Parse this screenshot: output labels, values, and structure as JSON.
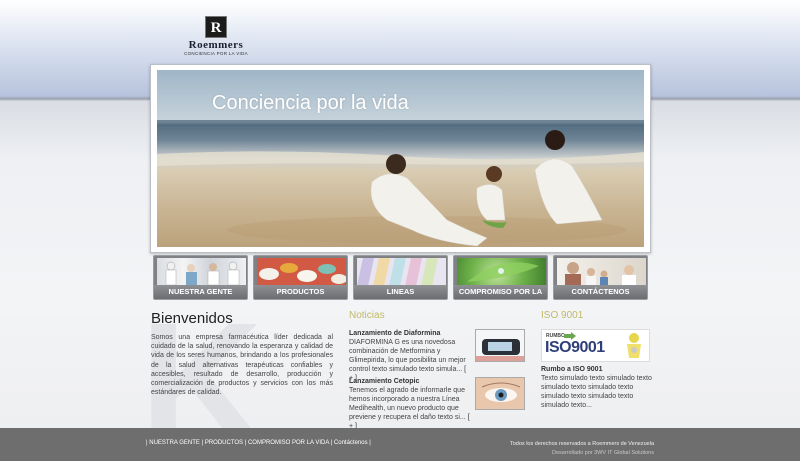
{
  "brand": {
    "logo_letter": "R",
    "name": "Roemmers",
    "tagline": "CONCIENCIA POR LA VIDA"
  },
  "hero": {
    "title": "Conciencia por la vida"
  },
  "nav": [
    {
      "label": "NUESTRA GENTE"
    },
    {
      "label": "PRODUCTOS"
    },
    {
      "label": "LINEAS"
    },
    {
      "label": "COMPROMISO POR LA VIDA"
    },
    {
      "label": "CONTÁCTENOS"
    }
  ],
  "welcome": {
    "title": "Bienvenidos",
    "text": "Somos una empresa farmacéutica líder dedicada al cuidado de la salud, renovando la esperanza y calidad de vida de los seres humanos, brindando a los profesionales de la salud alternativas terapéuticas confiables y accesibles, resultado de desarrollo, producción y comercialización de productos y servicios con los más estándares de calidad."
  },
  "news": {
    "title": "Noticias",
    "items": [
      {
        "headline": "Lanzamiento de Diaformina",
        "body": "DIAFORMINA G es una novedosa combinación de Metformina y Glimepirida, lo que posibilita un mejor control texto simulado texto simula...",
        "more": "[ + ]"
      },
      {
        "headline": "Lanzamiento Cetopic",
        "body": "Tenemos el agrado de informarle que hemos incorporado a nuestra Línea Medihealth, un nuevo producto que previene y recupera el daño texto si...",
        "more": "[ + ]"
      }
    ]
  },
  "iso": {
    "title": "ISO 9001",
    "banner_small": "RUMBO",
    "banner_big": "ISO9001",
    "headline": "Rumbo a ISO 9001",
    "body": "Texto simulado texto simulado texto simulado texto simulado texto simulado texto simulado texto simulado texto..."
  },
  "footer": {
    "links": [
      "NUESTRA GENTE",
      "PRODUCTOS",
      "COMPROMISO POR LA VIDA",
      "Contáctenos"
    ],
    "rights": "Todos los derechos reservados a Roemmers de Venezuela",
    "developer": "Desarrollado por 3WV IT Global Solutions"
  },
  "colors": {
    "section_title": "#c2b96a",
    "footer_bg": "#6e6e6e",
    "nav_bg": "#7f8185"
  }
}
